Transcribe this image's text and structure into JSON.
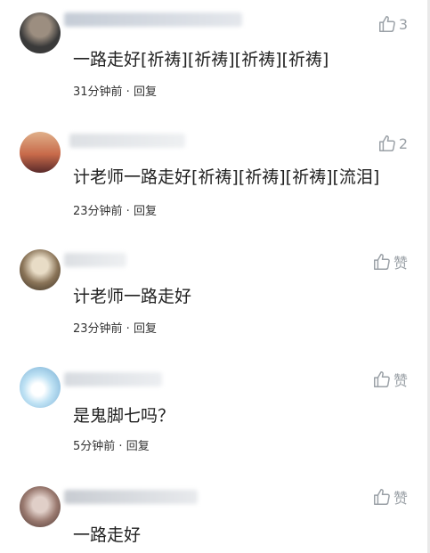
{
  "comments": [
    {
      "text": "一路走好[祈祷][祈祷][祈祷][祈祷]",
      "time": "31分钟前",
      "separator": " · ",
      "reply_label": "回复",
      "like_label": "3",
      "avatar_colors": [
        "#3a3a3a",
        "#9c8e80"
      ]
    },
    {
      "text": "计老师一路走好[祈祷][祈祷][祈祷][流泪]",
      "time": "23分钟前",
      "separator": " · ",
      "reply_label": "回复",
      "like_label": "2",
      "avatar_colors": [
        "#e0b08a",
        "#a23a2a"
      ]
    },
    {
      "text": "计老师一路走好",
      "time": "23分钟前",
      "separator": " · ",
      "reply_label": "回复",
      "like_label": "赞",
      "avatar_colors": [
        "#cfc8b8",
        "#6a5a40"
      ]
    },
    {
      "text": "是鬼脚七吗？",
      "time": "5分钟前",
      "separator": " · ",
      "reply_label": "回复",
      "like_label": "赞",
      "avatar_colors": [
        "#d6eef8",
        "#7fb4d6"
      ]
    },
    {
      "text": "一路走好",
      "time": "",
      "separator": "",
      "reply_label": "",
      "like_label": "赞",
      "avatar_colors": [
        "#8a6e64",
        "#d9c8c2"
      ]
    }
  ]
}
